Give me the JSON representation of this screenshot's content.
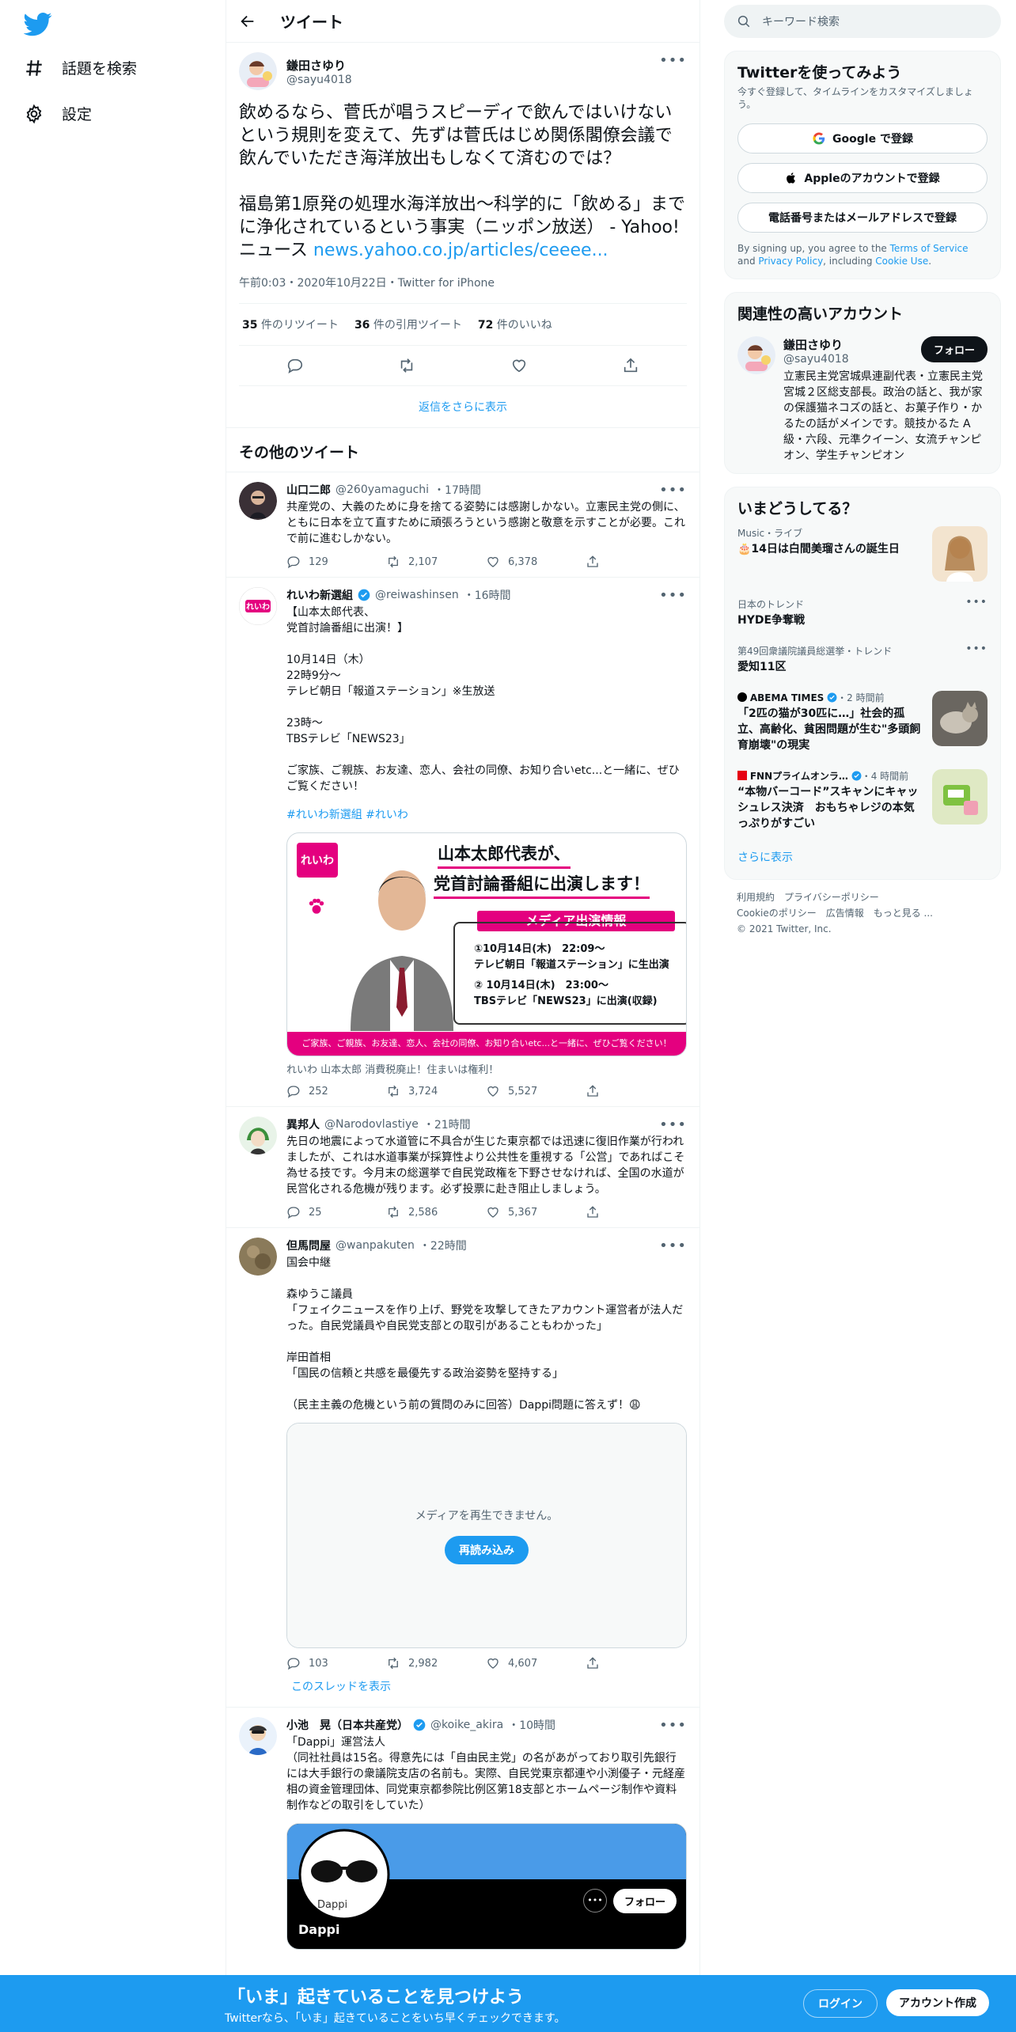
{
  "nav": {
    "explore": "話題を検索",
    "settings": "設定"
  },
  "header": {
    "title": "ツイート"
  },
  "focus": {
    "name": "鎌田さゆり",
    "handle": "@sayu4018",
    "text": "飲めるなら、菅氏が唱うスピーディで飲んではいけないという規則を変えて、先ずは菅氏はじめ関係閣僚会議で飲んでいただき海洋放出もしなくて済むのでは？\n\n福島第1原発の処理水海洋放出～科学的に「飲める」までに浄化されているという事実（ニッポン放送） - Yahoo!ニュース ",
    "link": "news.yahoo.co.jp/articles/ceeee...",
    "meta": "午前0:03・2020年10月22日・Twitter for iPhone",
    "retweets": "35",
    "retweets_label": " 件のリツイート",
    "quotes": "36",
    "quotes_label": " 件の引用ツイート",
    "likes": "72",
    "likes_label": " 件のいいね",
    "more_replies": "返信をさらに表示"
  },
  "section_title": "その他のツイート",
  "tweets": [
    {
      "name": "山口二郎",
      "handle": "@260yamaguchi",
      "time": "・17時間",
      "text": "共産党の、大義のために身を捨てる姿勢には感謝しかない。立憲民主党の側に、ともに日本を立て直すために頑張ろうという感謝と敬意を示すことが必要。これで前に進むしかない。",
      "replies": "129",
      "rts": "2,107",
      "likes": "6,378"
    },
    {
      "name": "れいわ新選組",
      "handle": "@reiwashinsen",
      "time": "・16時間",
      "text": "【山本太郎代表、\n党首討論番組に出演！】\n\n10月14日（木）\n22時9分～\nテレビ朝日「報道ステーション」※生放送\n\n23時～\nTBSテレビ「NEWS23」\n\nご家族、ご親族、お友達、恋人、会社の同僚、お知り合いetc...と一緒に、ぜひご覧ください！",
      "hashtags": "#れいわ新選組 #れいわ",
      "img_title1": "山本太郎代表が、",
      "img_title2": "党首討論番組に出演します！",
      "img_badge": "メディア出演情報",
      "img_line1": "①10月14日(木)　22:09～",
      "img_line2": "テレビ朝日「報道ステーション」に生出演",
      "img_line3": "② 10月14日(木)　23:00～",
      "img_line4": "TBSテレビ「NEWS23」に出演(収録)",
      "img_footer": "ご家族、ご親族、お友達、恋人、会社の同僚、お知り合いetc...と一緒に、ぜひご覧ください！",
      "img_logo": "れいわ",
      "caption": "れいわ 山本太郎 消費税廃止！住まいは権利！",
      "replies": "252",
      "rts": "3,724",
      "likes": "5,527"
    },
    {
      "name": "異邦人",
      "handle": "@Narodovlastiye",
      "time": "・21時間",
      "text": "先日の地震によって水道管に不具合が生じた東京都では迅速に復旧作業が行われましたが、これは水道事業が採算性より公共性を重視する「公営」であればこそ為せる技です。今月末の総選挙で自民党政権を下野させなければ、全国の水道が民営化される危機が残ります。必ず投票に赴き阻止しましょう。",
      "replies": "25",
      "rts": "2,586",
      "likes": "5,367"
    },
    {
      "name": "但馬問屋",
      "handle": "@wanpakuten",
      "time": "・22時間",
      "text": "国会中継\n\n森ゆうこ議員\n「フェイクニュースを作り上げ、野党を攻撃してきたアカウント運営者が法人だった。自民党議員や自民党支部との取引があることもわかった」\n\n岸田首相\n「国民の信頼と共感を最優先する政治姿勢を堅持する」\n\n（民主主義の危機という前の質問のみに回答）Dappi問題に答えず！😩",
      "media_error": "メディアを再生できません。",
      "reload": "再読み込み",
      "replies": "103",
      "rts": "2,982",
      "likes": "4,607",
      "thread": "このスレッドを表示"
    },
    {
      "name": "小池　晃（日本共産党）",
      "handle": "@koike_akira",
      "time": "・10時間",
      "text": "「Dappi」運営法人\n（同社社員は15名。得意先には「自由民主党」の名があがっており取引先銀行には大手銀行の衆議院支店の名前も。実際、自民党東京都連や小渕優子・元経産相の資金管理団体、同党東京都参院比例区第18支部とホームページ制作や資料制作などの取引をしていた）",
      "card_avatar": "Dappi",
      "card_follow": "フォロー",
      "card_name": "Dappi"
    }
  ],
  "sidebar": {
    "search_placeholder": "キーワード検索",
    "signup": {
      "title": "Twitterを使ってみよう",
      "sub": "今すぐ登録して、タイムラインをカスタマイズしましょう。",
      "google": "Google で登録",
      "apple": "Appleのアカウントで登録",
      "phone": "電話番号またはメールアドレスで登録",
      "terms_pre": "By signing up, you agree to the ",
      "terms_tos": "Terms of Service",
      "terms_and": " and ",
      "terms_privacy": "Privacy Policy",
      "terms_inc": ", including ",
      "terms_cookie": "Cookie Use",
      "terms_end": "."
    },
    "related": {
      "title": "関連性の高いアカウント",
      "name": "鎌田さゆり",
      "handle": "@sayu4018",
      "follow": "フォロー",
      "bio": "立憲民主党宮城県連副代表・立憲民主党宮城２区総支部長。政治の話と、我が家の保護猫ネコズの話と、お菓子作り・かるたの話がメインです。競技かるた A級・六段、元準クイーン、女流チャンピオン、学生チャンピオン"
    },
    "trends": {
      "title": "いまどうしてる？",
      "items": [
        {
          "meta": "Music・ライブ",
          "title": "🎂14日は白間美瑠さんの誕生日"
        },
        {
          "meta": "日本のトレンド",
          "title": "HYDE争奪戦"
        },
        {
          "meta": "第49回衆議院議員総選挙・トレンド",
          "title": "愛知11区"
        },
        {
          "meta": "ABEMA TIMES",
          "meta2": "・2 時間前",
          "title": "「2匹の猫が30匹に…」社会的孤立、高齢化、貧困問題が生む\"多頭飼育崩壊\"の現実"
        },
        {
          "meta": "FNNプライムオンラ…",
          "meta2": "・4 時間前",
          "title": "“本物バーコード”スキャンにキャッシュレス決済　おもちゃレジの本気っぷりがすごい"
        }
      ],
      "more": "さらに表示"
    },
    "footer": {
      "l1": "利用規約　プライバシーポリシー",
      "l2": "Cookieのポリシー　広告情報　もっと見る ...",
      "l3": "© 2021 Twitter, Inc."
    }
  },
  "bottom": {
    "title": "「いま」起きていることを見つけよう",
    "sub": "Twitterなら、「いま」起きていることをいち早くチェックできます。",
    "login": "ログイン",
    "signup": "アカウント作成"
  },
  "colors": {
    "accent": "#1d9bf0",
    "reiwa_pink": "#e4007f"
  }
}
